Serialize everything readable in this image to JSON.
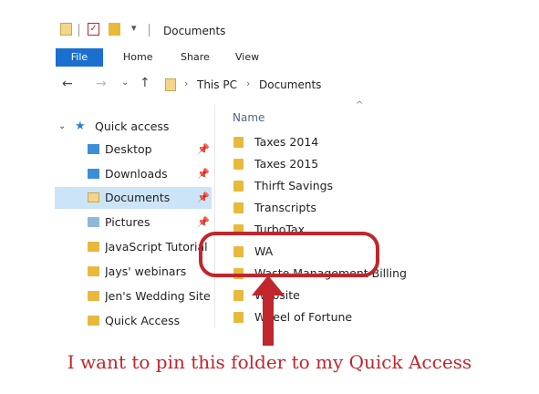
{
  "window": {
    "title": "Documents"
  },
  "ribbon": {
    "tabs": [
      "File",
      "Home",
      "Share",
      "View"
    ]
  },
  "address": {
    "segments": [
      "This PC",
      "Documents"
    ]
  },
  "nav": {
    "quick_access_label": "Quick access",
    "items": [
      {
        "label": "Desktop",
        "icon": "desktop-icon",
        "pinned": true
      },
      {
        "label": "Downloads",
        "icon": "downloads-icon",
        "pinned": true
      },
      {
        "label": "Documents",
        "icon": "documents-icon",
        "pinned": true,
        "selected": true
      },
      {
        "label": "Pictures",
        "icon": "pictures-icon",
        "pinned": true
      },
      {
        "label": "JavaScript Tutorial",
        "icon": "folder-icon"
      },
      {
        "label": "Jays' webinars",
        "icon": "folder-icon"
      },
      {
        "label": "Jen's Wedding Site",
        "icon": "folder-icon"
      },
      {
        "label": "Quick Access",
        "icon": "folder-icon"
      }
    ]
  },
  "files": {
    "column_header": "Name",
    "items": [
      "Taxes 2014",
      "Taxes 2015",
      "Thirft Savings",
      "Transcripts",
      "TurboTax",
      "WA",
      "Waste Management Billing",
      "Website",
      "Wheel of Fortune"
    ]
  },
  "annotation": {
    "caption": "I want to pin this folder to my Quick Access",
    "color": "#c0262c"
  },
  "colors": {
    "accent": "#1b6fcf",
    "selection": "#cce4f7",
    "folder": "#e8b93a"
  }
}
